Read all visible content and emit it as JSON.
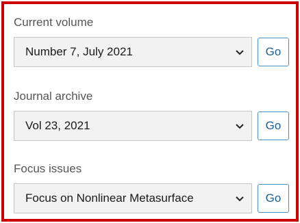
{
  "sections": [
    {
      "label": "Current volume",
      "selected": "Number 7, July 2021",
      "button": "Go"
    },
    {
      "label": "Journal archive",
      "selected": "Vol 23, 2021",
      "button": "Go"
    },
    {
      "label": "Focus issues",
      "selected": "Focus on Nonlinear Metasurface",
      "button": "Go"
    }
  ],
  "colors": {
    "highlight_border": "#cc0000",
    "button_text": "#1a5e96",
    "button_border": "#4a8fc4",
    "select_bg": "#f2f2f2"
  }
}
